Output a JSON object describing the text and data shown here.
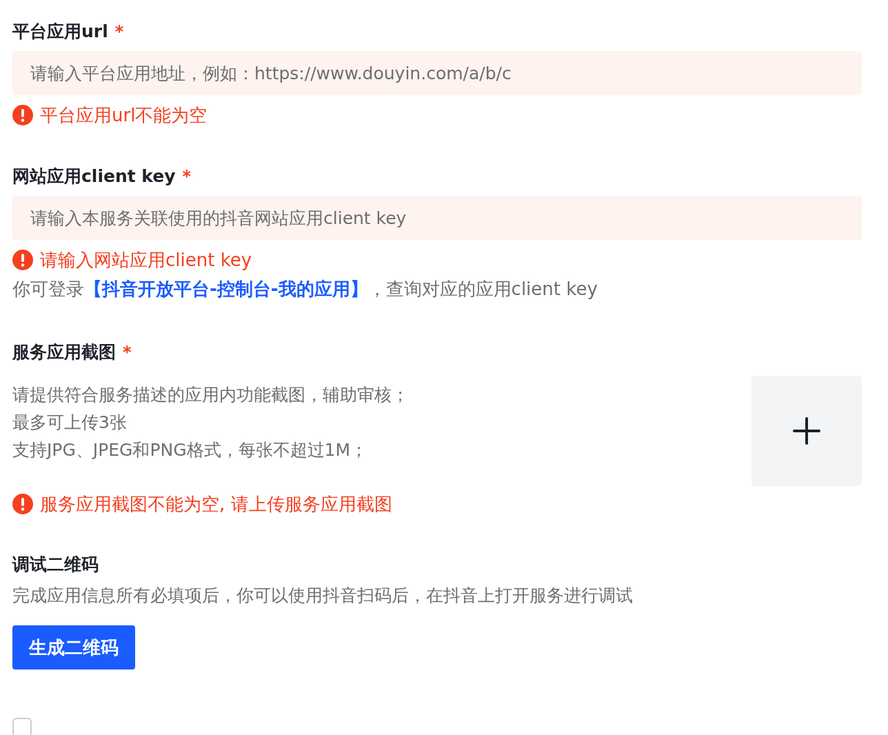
{
  "fields": [
    {
      "kind": "input",
      "label": "平台应用url",
      "required_mark": "*",
      "placeholder": "请输入平台应用地址，例如：https://www.douyin.com/a/b/c",
      "error": "平台应用url不能为空"
    },
    {
      "kind": "input",
      "label": "网站应用client key",
      "required_mark": "*",
      "placeholder": "请输入本服务关联使用的抖音网站应用client key",
      "error": "请输入网站应用client key",
      "hint": {
        "prefix": "你可登录",
        "link": "【抖音开放平台-控制台-我的应用】",
        "suffix": "，查询对应的应用client key"
      }
    },
    {
      "kind": "upload",
      "label": "服务应用截图",
      "required_mark": "*",
      "description": [
        "请提供符合服务描述的应用内功能截图，辅助审核；最多可上传3张",
        "支持JPG、JPEG和PNG格式，每张不超过1M；"
      ],
      "error": "服务应用截图不能为空, 请上传服务应用截图"
    }
  ],
  "qrcode": {
    "title": "调试二维码",
    "description": "完成应用信息所有必填项后，你可以使用抖音扫码后，在抖音上打开服务进行调试",
    "button": "生成二维码"
  },
  "agreement": {
    "checked": false
  }
}
